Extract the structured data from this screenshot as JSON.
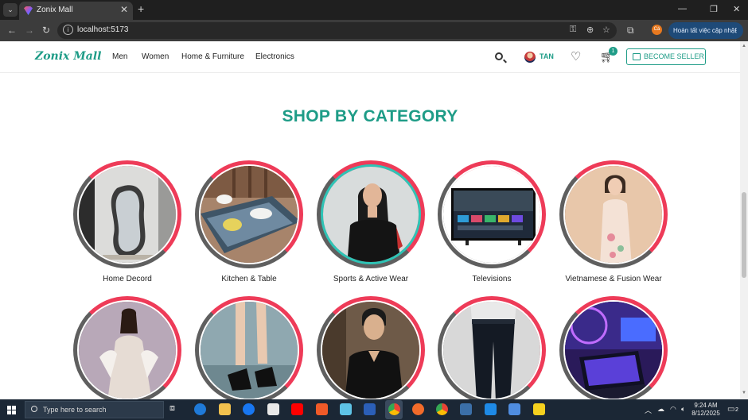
{
  "browser": {
    "tab_title": "Zonix Mall",
    "url": "localhost:5173",
    "update_button": "Hoàn tất việc cập nhật",
    "profile_initials": "Cá"
  },
  "site": {
    "logo": "Zonix Mall",
    "nav": [
      "Men",
      "Women",
      "Home & Furniture",
      "Electronics"
    ],
    "user_name": "TAN",
    "cart_count": "1",
    "seller_button": "BECOME SELLER",
    "accent_color": "#1e9c87"
  },
  "section": {
    "title": "SHOP BY CATEGORY"
  },
  "categories": [
    {
      "label": "Home Decord",
      "icon": "mirror-photo"
    },
    {
      "label": "Kitchen & Table",
      "icon": "dining-table-photo"
    },
    {
      "label": "Sports & Active Wear",
      "icon": "sportswear-photo"
    },
    {
      "label": "Televisions",
      "icon": "tv-photo"
    },
    {
      "label": "Vietnamese & Fusion Wear",
      "icon": "ao-dai-photo"
    },
    {
      "label": "",
      "icon": "gown-photo"
    },
    {
      "label": "",
      "icon": "heels-photo"
    },
    {
      "label": "",
      "icon": "men-shirt-photo"
    },
    {
      "label": "",
      "icon": "jeans-photo"
    },
    {
      "label": "",
      "icon": "gaming-laptop-photo"
    }
  ],
  "taskbar": {
    "search_placeholder": "Type here to search",
    "time": "9:24 AM",
    "date": "8/12/2025",
    "notification_count": "2"
  }
}
